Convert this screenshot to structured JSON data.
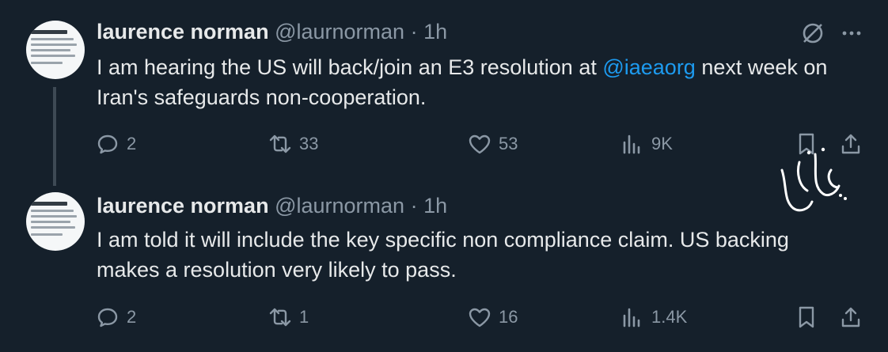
{
  "tweets": [
    {
      "author_name": "laurence norman",
      "handle": "@laurnorman",
      "separator": "·",
      "time": "1h",
      "text_before": "I am hearing the US will back/join an E3 resolution at ",
      "mention": "@iaeaorg",
      "text_after": " next week on Iran's safeguards non-cooperation.",
      "replies": "2",
      "reposts": "33",
      "likes": "53",
      "views": "9K"
    },
    {
      "author_name": "laurence norman",
      "handle": "@laurnorman",
      "separator": "·",
      "time": "1h",
      "text": "I am told it will include the key specific non compliance claim. US backing makes a resolution very likely to pass.",
      "replies": "2",
      "reposts": "1",
      "likes": "16",
      "views": "1.4K"
    }
  ],
  "icons": {
    "grok": "grok-icon",
    "more": "more-icon",
    "reply": "reply-icon",
    "repost": "repost-icon",
    "like": "like-icon",
    "views": "views-icon",
    "bookmark": "bookmark-icon",
    "share": "share-icon"
  },
  "colors": {
    "background": "#15202b",
    "text": "#e7e9ea",
    "secondary": "#8b98a5",
    "accent": "#1d9bf0"
  }
}
